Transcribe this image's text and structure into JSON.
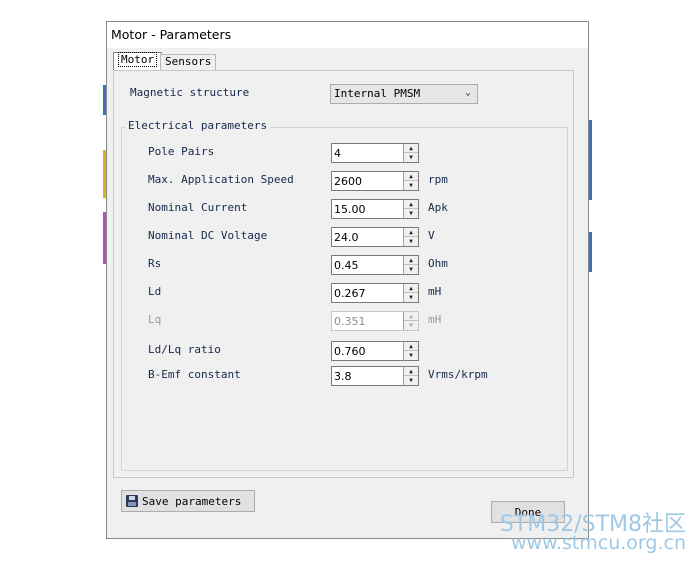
{
  "dialog": {
    "title": "Motor - Parameters",
    "tabs": [
      {
        "label": "Motor",
        "active": true
      },
      {
        "label": "Sensors",
        "active": false
      }
    ]
  },
  "magnetic_structure": {
    "label": "Magnetic structure",
    "value": "Internal PMSM"
  },
  "electrical": {
    "group_title": "Electrical parameters",
    "fields": [
      {
        "label": "Pole Pairs",
        "value": "4",
        "unit": ""
      },
      {
        "label": "Max. Application Speed",
        "value": "2600",
        "unit": "rpm"
      },
      {
        "label": "Nominal Current",
        "value": "15.00",
        "unit": "Apk"
      },
      {
        "label": "Nominal DC Voltage",
        "value": "24.0",
        "unit": "V"
      },
      {
        "label": "Rs",
        "value": "0.45",
        "unit": "Ohm"
      },
      {
        "label": "Ld",
        "value": "0.267",
        "unit": "mH"
      },
      {
        "label": "Lq",
        "value": "0.351",
        "unit": "mH",
        "disabled": true
      },
      {
        "label": "Ld/Lq ratio",
        "value": "0.760",
        "unit": ""
      },
      {
        "label": "B-Emf constant",
        "value": "3.8",
        "unit": "Vrms/krpm"
      }
    ]
  },
  "buttons": {
    "save": "Save parameters",
    "done": "Done"
  },
  "watermark": {
    "line1": "STM32/STM8社区",
    "line2": "www.stmcu.org.cn"
  }
}
